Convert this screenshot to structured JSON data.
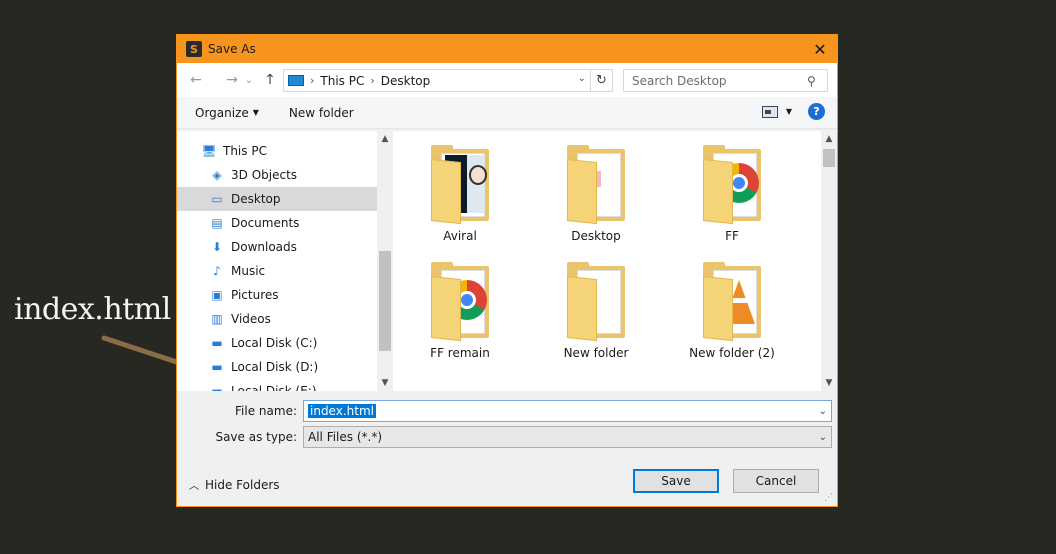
{
  "annotation": {
    "text": "index.html"
  },
  "dialog": {
    "title": "Save As",
    "close_symbol": "✕",
    "app_icon": "sublime-text-icon"
  },
  "navigation": {
    "back": "←",
    "forward": "→",
    "recent": "⌄",
    "up": "↑",
    "breadcrumb": [
      "This PC",
      "Desktop"
    ],
    "refresh": "↻",
    "search_placeholder": "Search Desktop"
  },
  "toolbar": {
    "organize_label": "Organize",
    "new_folder_label": "New folder",
    "help_label": "?"
  },
  "sidebar": {
    "items": [
      {
        "label": "This PC",
        "icon": "computer-icon",
        "glyph": "🖥",
        "indent": 0
      },
      {
        "label": "3D Objects",
        "icon": "cube-icon",
        "glyph": "◈",
        "indent": 1
      },
      {
        "label": "Desktop",
        "icon": "desktop-icon",
        "glyph": "▭",
        "indent": 1,
        "selected": true
      },
      {
        "label": "Documents",
        "icon": "document-icon",
        "glyph": "▤",
        "indent": 1
      },
      {
        "label": "Downloads",
        "icon": "download-icon",
        "glyph": "⬇",
        "indent": 1
      },
      {
        "label": "Music",
        "icon": "music-icon",
        "glyph": "♪",
        "indent": 1
      },
      {
        "label": "Pictures",
        "icon": "picture-icon",
        "glyph": "▣",
        "indent": 1
      },
      {
        "label": "Videos",
        "icon": "video-icon",
        "glyph": "▥",
        "indent": 1
      },
      {
        "label": "Local Disk (C:)",
        "icon": "drive-icon",
        "glyph": "▬",
        "indent": 1
      },
      {
        "label": "Local Disk (D:)",
        "icon": "drive-icon",
        "glyph": "▬",
        "indent": 1
      },
      {
        "label": "Local Disk (E:)",
        "icon": "drive-icon",
        "glyph": "▬",
        "indent": 1
      }
    ]
  },
  "files": [
    {
      "label": "Aviral",
      "icon": "folder-photo-icon"
    },
    {
      "label": "Desktop",
      "icon": "folder-icon"
    },
    {
      "label": "FF",
      "icon": "folder-chrome-icon"
    },
    {
      "label": "FF remain",
      "icon": "folder-chrome-icon"
    },
    {
      "label": "New folder",
      "icon": "folder-icon"
    },
    {
      "label": "New folder (2)",
      "icon": "folder-vlc-icon"
    }
  ],
  "form": {
    "file_name_label": "File name:",
    "file_name_value": "index.html",
    "save_type_label": "Save as type:",
    "save_type_value": "All Files (*.*)"
  },
  "footer": {
    "hide_folders_label": "Hide Folders",
    "save_label": "Save",
    "cancel_label": "Cancel"
  },
  "colors": {
    "title_bar": "#f7941d",
    "selection": "#0078d7",
    "background": "#272822"
  }
}
